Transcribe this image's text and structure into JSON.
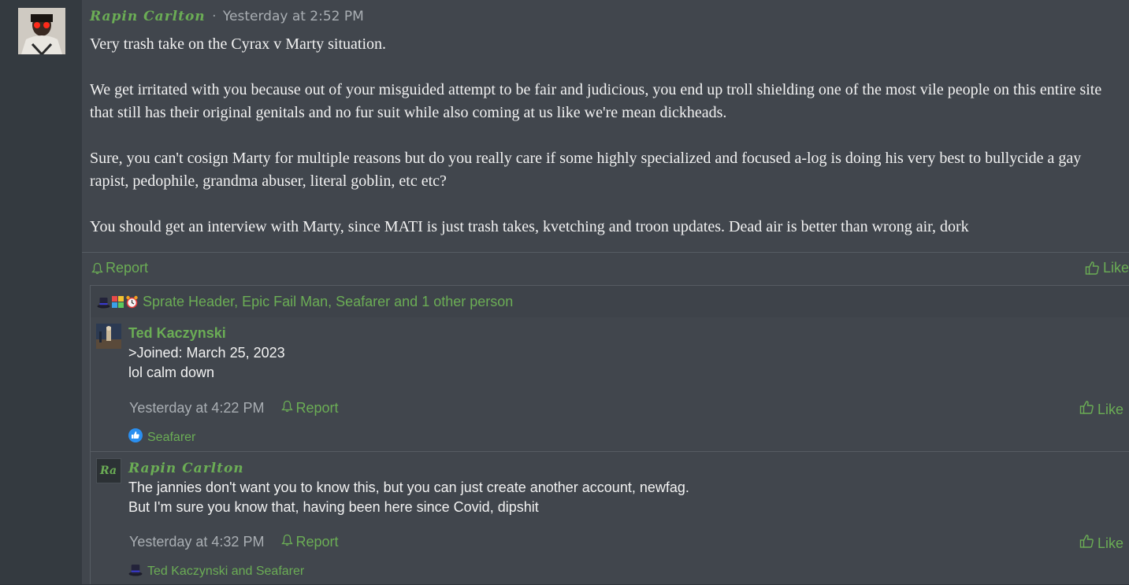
{
  "post": {
    "author": "Rapin Carlton",
    "separator": "·",
    "timestamp": "Yesterday at 2:52 PM",
    "paragraphs": [
      "Very trash take on the Cyrax v Marty situation.",
      "We get irritated with you because out of your misguided attempt to be fair and judicious, you end up troll shielding one of the most vile people on this entire site that still has their original genitals and no fur suit while also coming at us like we're mean dickheads.",
      "Sure, you can't cosign Marty for multiple reasons but do you really care if some highly specialized and focused a-log is doing his very best to bullycide a gay rapist, pedophile, grandma abuser, literal goblin, etc etc?",
      "You should get an interview with Marty, since MATI is just trash takes, kvetching and troon updates. Dead air is better than wrong air, dork"
    ],
    "report_label": "Report",
    "like_label": "Like",
    "reactions_text": "Sprate Header, Epic Fail Man, Seafarer and 1 other person",
    "reaction_icons": [
      "top-hat-icon",
      "puzzle-icon",
      "alarm-clock-icon"
    ]
  },
  "comments": [
    {
      "author": "Ted Kaczynski",
      "lines": [
        ">Joined: March 25, 2023",
        "lol calm down"
      ],
      "timestamp": "Yesterday at 4:22 PM",
      "report_label": "Report",
      "like_label": "Like",
      "reactions": "Seafarer",
      "reaction_icon": "thumbs-up-icon"
    },
    {
      "author": "Rapin Carlton",
      "avatar_text": "Ra",
      "lines": [
        "The jannies don't want you to know this, but you can just create another account, newfag.",
        "But I'm sure you know that, having been here since Covid, dipshit"
      ],
      "timestamp": "Yesterday at 4:32 PM",
      "report_label": "Report",
      "like_label": "Like",
      "reactions": "Ted Kaczynski and Seafarer",
      "reaction_icon": "top-hat-icon"
    }
  ],
  "colors": {
    "accent": "#6bad55",
    "background": "#41464d",
    "gutter": "#343a40"
  }
}
